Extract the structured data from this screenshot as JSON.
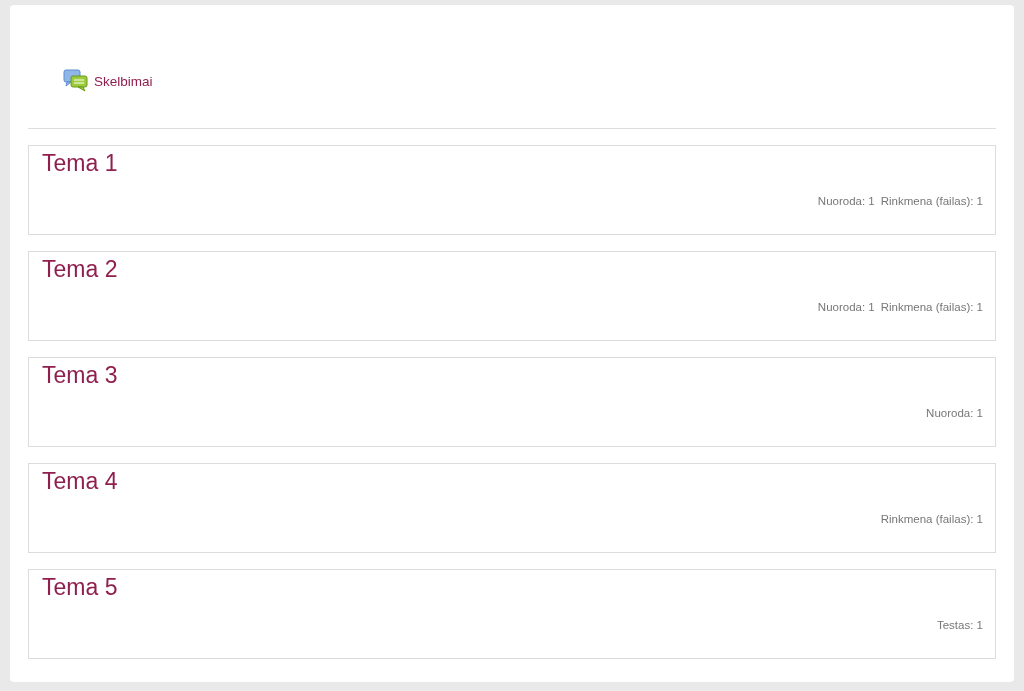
{
  "announcements": {
    "label": "Skelbimai"
  },
  "sections": [
    {
      "title": "Tema 1",
      "summary": [
        "Nuoroda: 1",
        "Rinkmena (failas): 1"
      ]
    },
    {
      "title": "Tema 2",
      "summary": [
        "Nuoroda: 1",
        "Rinkmena (failas): 1"
      ]
    },
    {
      "title": "Tema 3",
      "summary": [
        "Nuoroda: 1"
      ]
    },
    {
      "title": "Tema 4",
      "summary": [
        "Rinkmena (failas): 1"
      ]
    },
    {
      "title": "Tema 5",
      "summary": [
        "Testas: 1"
      ]
    }
  ]
}
